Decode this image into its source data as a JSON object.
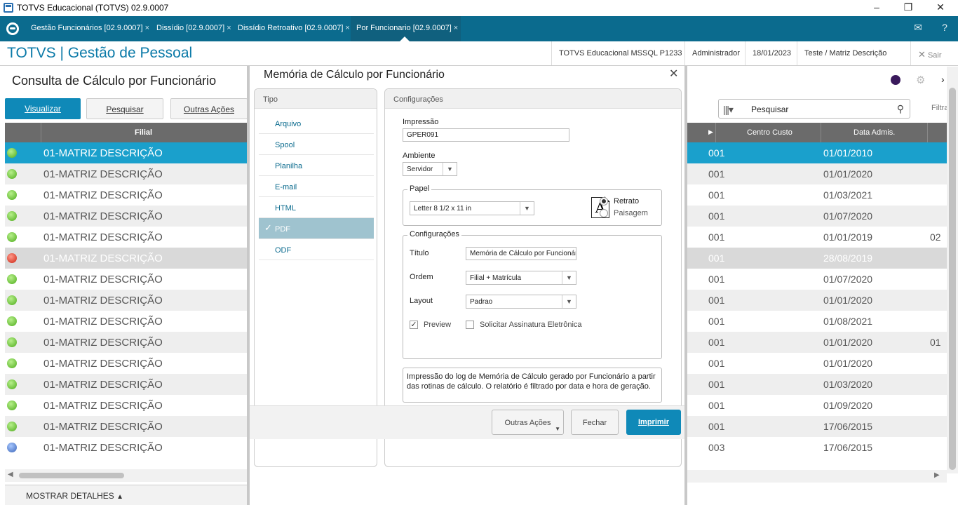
{
  "window": {
    "title": "TOTVS Educacional (TOTVS) 02.9.0007"
  },
  "tabs": [
    {
      "label": "Gestão Funcionários [02.9.0007]"
    },
    {
      "label": "Dissídio [02.9.0007]"
    },
    {
      "label": "Dissídio Retroativo [02.9.0007]"
    },
    {
      "label": "Por Funcionario [02.9.0007]"
    }
  ],
  "header": {
    "brand": "TOTVS | Gestão de Pessoal",
    "environment": "TOTVS Educacional MSSQL P1233",
    "user": "Administrador",
    "date": "18/01/2023",
    "branch": "Teste / Matriz Descrição",
    "exit": "Sair"
  },
  "left": {
    "page_title": "Consulta de Cálculo por Funcionário",
    "btn_visualizar": "Visualizar",
    "btn_pesquisar": "Pesquisar",
    "btn_outras": "Outras Ações",
    "col_filial": "Filial",
    "rows": [
      {
        "status": "green",
        "filial": "01-MATRIZ DESCRIÇÃO"
      },
      {
        "status": "green",
        "filial": "01-MATRIZ DESCRIÇÃO"
      },
      {
        "status": "green",
        "filial": "01-MATRIZ DESCRIÇÃO"
      },
      {
        "status": "green",
        "filial": "01-MATRIZ DESCRIÇÃO"
      },
      {
        "status": "green",
        "filial": "01-MATRIZ DESCRIÇÃO"
      },
      {
        "status": "red",
        "filial": "01-MATRIZ DESCRIÇÃO"
      },
      {
        "status": "green",
        "filial": "01-MATRIZ DESCRIÇÃO"
      },
      {
        "status": "green",
        "filial": "01-MATRIZ DESCRIÇÃO"
      },
      {
        "status": "green",
        "filial": "01-MATRIZ DESCRIÇÃO"
      },
      {
        "status": "green",
        "filial": "01-MATRIZ DESCRIÇÃO"
      },
      {
        "status": "green",
        "filial": "01-MATRIZ DESCRIÇÃO"
      },
      {
        "status": "green",
        "filial": "01-MATRIZ DESCRIÇÃO"
      },
      {
        "status": "green",
        "filial": "01-MATRIZ DESCRIÇÃO"
      },
      {
        "status": "green",
        "filial": "01-MATRIZ DESCRIÇÃO"
      },
      {
        "status": "blue",
        "filial": "01-MATRIZ DESCRIÇÃO"
      }
    ],
    "show_details": "MOSTRAR DETALHES"
  },
  "right": {
    "search_value": "Pesquisar",
    "filter_label": "Filtra",
    "col_centro": "Centro Custo",
    "col_data": "Data Admis.",
    "rows": [
      {
        "centro": "001",
        "data": "01/01/2010",
        "extra": ""
      },
      {
        "centro": "001",
        "data": "01/01/2020",
        "extra": ""
      },
      {
        "centro": "001",
        "data": "01/03/2021",
        "extra": ""
      },
      {
        "centro": "001",
        "data": "01/07/2020",
        "extra": ""
      },
      {
        "centro": "001",
        "data": "01/01/2019",
        "extra": "02"
      },
      {
        "centro": "001",
        "data": "28/08/2019",
        "extra": ""
      },
      {
        "centro": "001",
        "data": "01/07/2020",
        "extra": ""
      },
      {
        "centro": "001",
        "data": "01/01/2020",
        "extra": ""
      },
      {
        "centro": "001",
        "data": "01/08/2021",
        "extra": ""
      },
      {
        "centro": "001",
        "data": "01/01/2020",
        "extra": "01"
      },
      {
        "centro": "001",
        "data": "01/01/2020",
        "extra": ""
      },
      {
        "centro": "001",
        "data": "01/03/2020",
        "extra": ""
      },
      {
        "centro": "001",
        "data": "01/09/2020",
        "extra": ""
      },
      {
        "centro": "001",
        "data": "17/06/2015",
        "extra": ""
      },
      {
        "centro": "003",
        "data": "17/06/2015",
        "extra": ""
      }
    ]
  },
  "dialog": {
    "title": "Memória de Cálculo por Funcionário",
    "tipo_header": "Tipo",
    "tipo_items": [
      "Arquivo",
      "Spool",
      "Planilha",
      "E-mail",
      "HTML",
      "PDF",
      "ODF"
    ],
    "tipo_active": "PDF",
    "config_header": "Configurações",
    "impressao_label": "Impressão",
    "impressao_value": "GPER091",
    "ambiente_label": "Ambiente",
    "ambiente_value": "Servidor",
    "papel_legend": "Papel",
    "papel_value": "Letter 8 1/2 x 11 in",
    "paper_glyph": "A",
    "retrato": "Retrato",
    "paisagem": "Paisagem",
    "config_legend": "Configurações",
    "titulo_label": "Título",
    "titulo_value": "Memória de Cálculo por Funcionário",
    "ordem_label": "Ordem",
    "ordem_value": "Filial + Matrícula",
    "layout_label": "Layout",
    "layout_value": "Padrao",
    "preview_label": "Preview",
    "assinatura_label": "Solicitar Assinatura Eletrônica",
    "description": "Impressão do log de Memória de Cálculo gerado por Funcionário a partir das rotinas de cálculo. O relatório é filtrado por data e hora de geração.",
    "btn_outras": "Outras Ações",
    "btn_fechar": "Fechar",
    "btn_imprimir": "Imprimir"
  },
  "colors": {
    "brand_teal": "#0b6b8e",
    "primary_button": "#0f89b8",
    "selected_row": "#1aa0cc"
  }
}
